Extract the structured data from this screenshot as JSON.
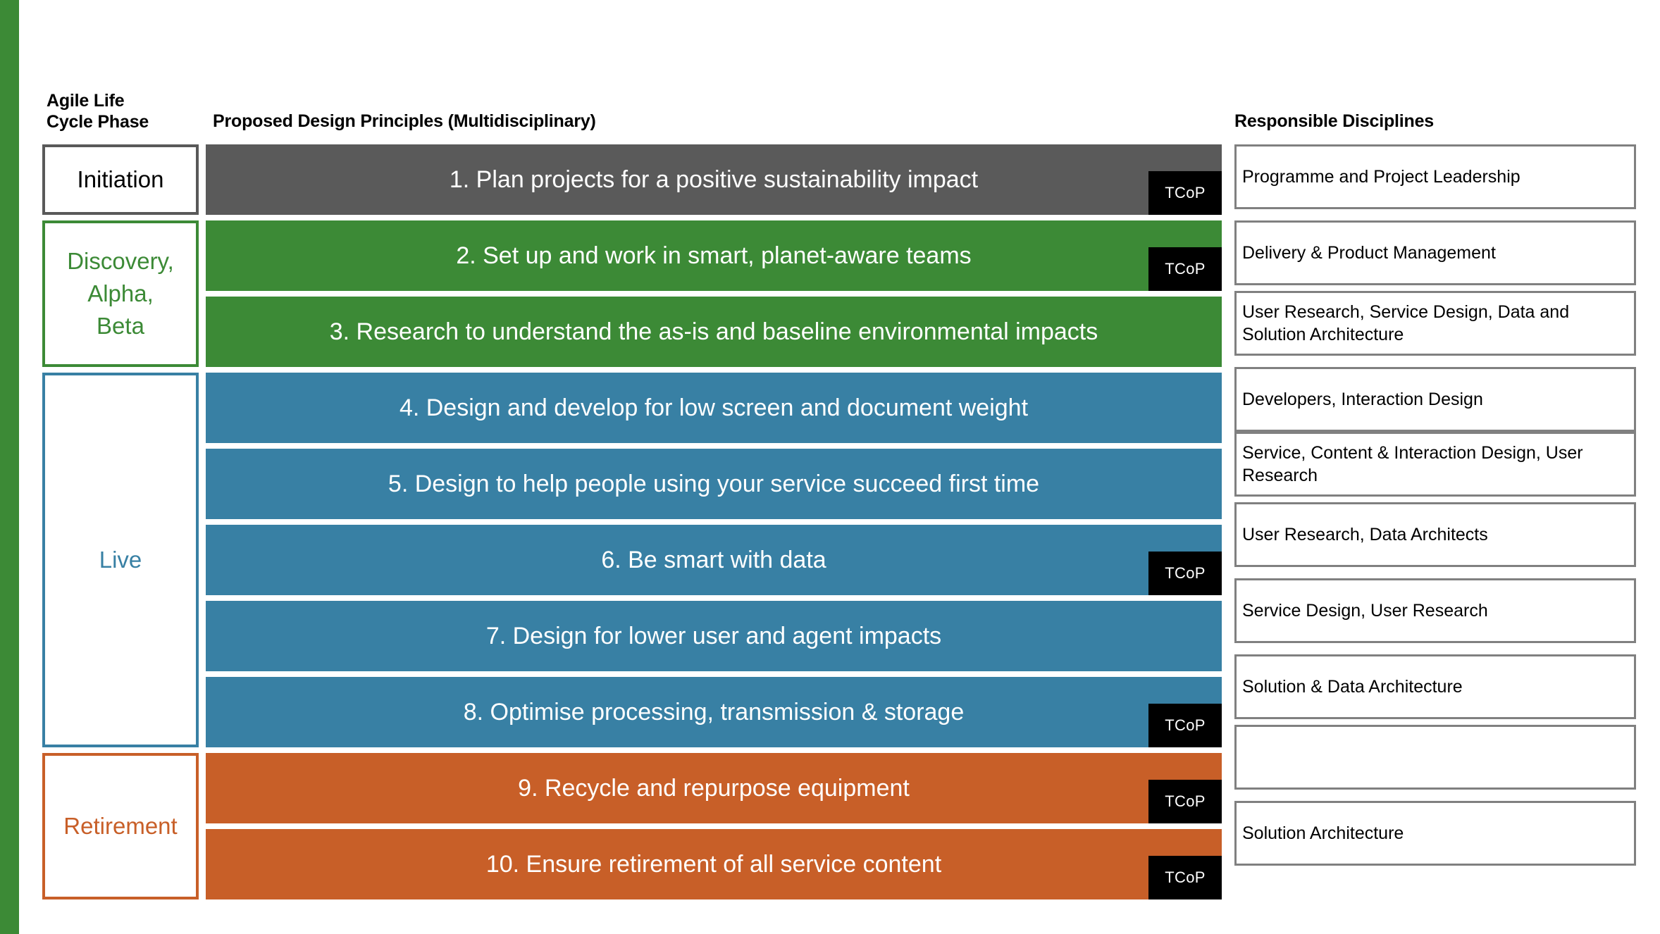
{
  "headers": {
    "phase": "Agile Life\nCycle Phase",
    "phase_line1": "Agile Life",
    "phase_line2": "Cycle Phase",
    "principles": "Proposed Design Principles (Multidisciplinary)",
    "disciplines": "Responsible Disciplines"
  },
  "colors": {
    "stripe": "#3c8a36",
    "gray": "#5a5a5a",
    "green": "#3c8a36",
    "blue": "#3880a4",
    "orange": "#c85f28",
    "badge": "#000000",
    "box_border": "#808080"
  },
  "badge_label": "TCoP",
  "phases": [
    {
      "label": "Initiation",
      "color_key": "gray",
      "lines": [
        "Initiation"
      ]
    },
    {
      "label": "Discovery, Alpha, Beta",
      "color_key": "green",
      "lines": [
        "Discovery,",
        "Alpha,",
        "Beta"
      ]
    },
    {
      "label": "Live",
      "color_key": "blue",
      "lines": [
        "Live"
      ]
    },
    {
      "label": "Retirement",
      "color_key": "orange",
      "lines": [
        "Retirement"
      ]
    }
  ],
  "principles": [
    {
      "number": "1.",
      "text": "1. Plan projects for a positive sustainability impact",
      "color_key": "gray",
      "has_badge": true
    },
    {
      "number": "2.",
      "text": "2. Set up and work in smart, planet-aware teams",
      "color_key": "green",
      "has_badge": true
    },
    {
      "number": "3.",
      "text": "3. Research to understand the as-is and baseline environmental impacts",
      "color_key": "green",
      "has_badge": false
    },
    {
      "number": "4.",
      "text": "4. Design and develop for low screen and document weight",
      "color_key": "blue",
      "has_badge": false
    },
    {
      "number": "5.",
      "text": "5. Design to help people using your service succeed first time",
      "color_key": "blue",
      "has_badge": false
    },
    {
      "number": "6.",
      "text": "6. Be smart with data",
      "color_key": "blue",
      "has_badge": true
    },
    {
      "number": "7.",
      "text": "7. Design for lower user and agent impacts",
      "color_key": "blue",
      "has_badge": false
    },
    {
      "number": "8.",
      "text": "8. Optimise processing, transmission & storage",
      "color_key": "blue",
      "has_badge": true
    },
    {
      "number": "9.",
      "text": "9. Recycle and repurpose equipment",
      "color_key": "orange",
      "has_badge": true
    },
    {
      "number": "10.",
      "text": "10. Ensure retirement of all service content",
      "color_key": "orange",
      "has_badge": true
    }
  ],
  "disciplines": [
    {
      "text": "Programme and Project Leadership"
    },
    {
      "text": "Delivery & Product Management"
    },
    {
      "text": "User Research, Service Design, Data and Solution Architecture"
    },
    {
      "text": "Developers, Interaction Design"
    },
    {
      "text": "Service, Content & Interaction Design, User Research"
    },
    {
      "text": "User Research, Data Architects"
    },
    {
      "text": "Service Design, User Research"
    },
    {
      "text": "Solution & Data Architecture"
    },
    {
      "text": ""
    },
    {
      "text": "Solution Architecture"
    }
  ]
}
